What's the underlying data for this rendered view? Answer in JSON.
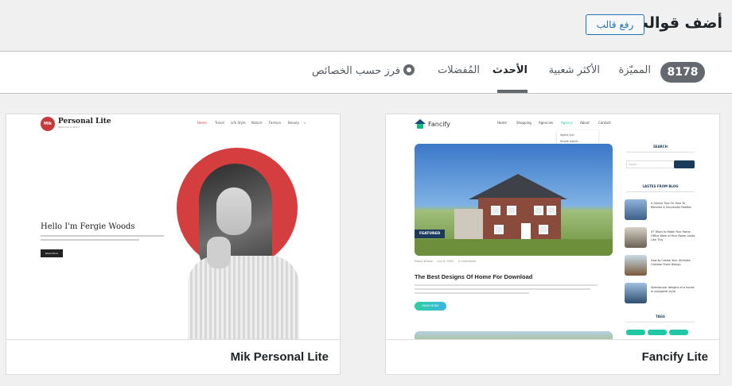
{
  "header": {
    "title": "أضف قوالب",
    "upload_button": "رفع قالب"
  },
  "filter_bar": {
    "count": "8178",
    "tabs": [
      {
        "label": "المميّزة",
        "active": false
      },
      {
        "label": "الأكثر شعبية",
        "active": false
      },
      {
        "label": "الأحدث",
        "active": true
      },
      {
        "label": "المُفضلات",
        "active": false
      }
    ],
    "feature_filter": "فرز حسب الخصائص",
    "feature_filter_icon": "gear-icon"
  },
  "themes": [
    {
      "name": "Fancify Lite",
      "preview": {
        "logo": "Fancify",
        "nav": [
          "Home",
          "Shopping",
          "Agencies",
          "Agency",
          "About",
          "Contact"
        ],
        "submenu": [
          "Agent List",
          "Single Agent"
        ],
        "featured_badge": "FEATURED",
        "meta_author": "Darsh Wilson",
        "meta_date": "July 8, 2020",
        "meta_comments": "0 Comments",
        "post_title": "The Best Designs Of Home For Download",
        "read_more": "READ MORE",
        "sidebar_search_title": "SEARCH",
        "sidebar_search_placeholder": "Search...",
        "sidebar_blog_title": "LASTES FROM BLOG",
        "blog_posts": [
          "A Stylish Tips On How To Become A Successful Realtor",
          "07 Ways to Make Your Home Office Work of Your Room Looks Like This",
          "How to Create Your Ultimate Outdoor Fixed Design",
          "Spectacular designs of a house in polygonal style"
        ],
        "sidebar_tags_title": "TAGS"
      }
    },
    {
      "name": "Mik Personal Lite",
      "preview": {
        "logo_mark": "Mik",
        "logo": "Personal Lite",
        "logo_tagline": "Welcome to World",
        "nav": [
          "Home",
          "Travel",
          "Life Style",
          "Nature",
          "Fashion",
          "Beauty"
        ],
        "heading": "Hello I'm Fergie Woods",
        "button": "Read More"
      }
    }
  ],
  "colors": {
    "accent": "#2271b1",
    "badge": "#646970",
    "personal_red": "#d53e3e",
    "fancify_green": "#21c8a5",
    "fancify_navy": "#1b3a5b"
  }
}
